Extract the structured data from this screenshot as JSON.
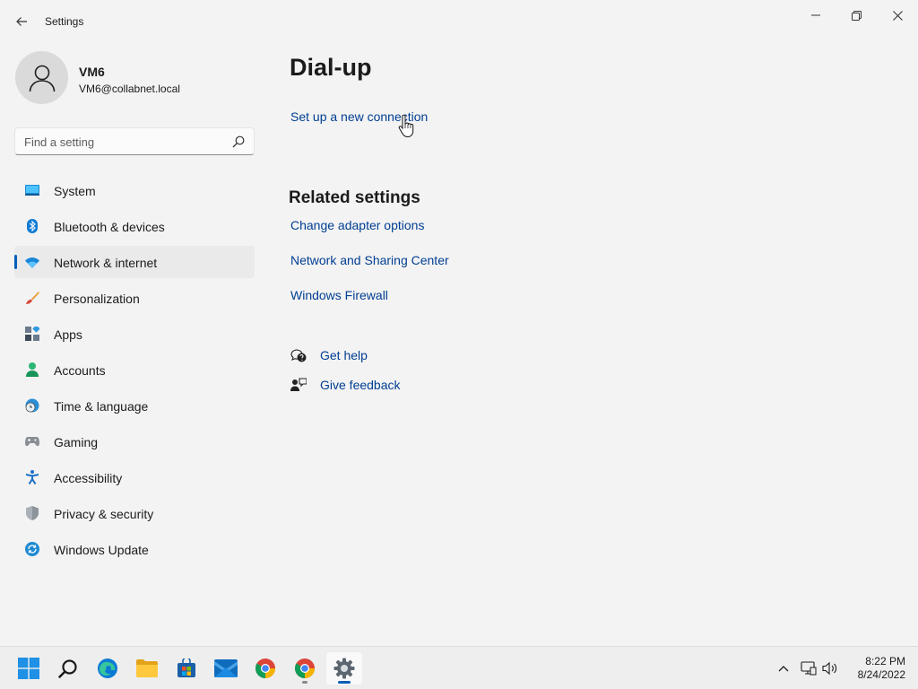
{
  "window": {
    "title": "Settings"
  },
  "profile": {
    "name": "VM6",
    "email": "VM6@collabnet.local"
  },
  "search": {
    "placeholder": "Find a setting"
  },
  "nav": {
    "items": [
      {
        "label": "System",
        "icon": "system-icon"
      },
      {
        "label": "Bluetooth & devices",
        "icon": "bluetooth-icon"
      },
      {
        "label": "Network & internet",
        "icon": "wifi-icon",
        "active": true
      },
      {
        "label": "Personalization",
        "icon": "brush-icon"
      },
      {
        "label": "Apps",
        "icon": "apps-icon"
      },
      {
        "label": "Accounts",
        "icon": "accounts-icon"
      },
      {
        "label": "Time & language",
        "icon": "clock-globe-icon"
      },
      {
        "label": "Gaming",
        "icon": "controller-icon"
      },
      {
        "label": "Accessibility",
        "icon": "accessibility-icon"
      },
      {
        "label": "Privacy & security",
        "icon": "shield-icon"
      },
      {
        "label": "Windows Update",
        "icon": "update-icon"
      }
    ]
  },
  "main": {
    "title": "Dial-up",
    "setup_link": "Set up a new connection",
    "related": {
      "title": "Related settings",
      "links": [
        "Change adapter options",
        "Network and Sharing Center",
        "Windows Firewall"
      ]
    },
    "help": {
      "get_help": "Get help",
      "give_feedback": "Give feedback"
    }
  },
  "taskbar": {
    "apps": [
      "start",
      "search",
      "edge",
      "file-explorer",
      "microsoft-store",
      "mail",
      "chrome",
      "chrome",
      "settings"
    ],
    "time": "8:22 PM",
    "date": "8/24/2022"
  },
  "colors": {
    "accent": "#005fb8",
    "link": "#003e92",
    "background": "#f3f3f3"
  }
}
